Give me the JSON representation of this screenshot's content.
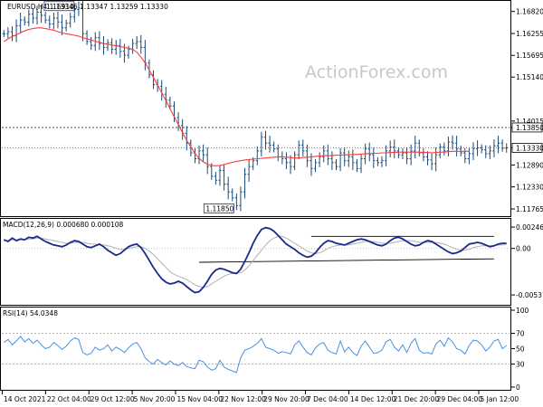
{
  "chart_data": {
    "type": "line",
    "price_panel": {
      "title": "EURUSD,H4  1.13346 1.13347 1.13259 1.13330",
      "ylim": [
        1.1735,
        1.1715
      ],
      "y_ticks": [
        "1.16820",
        "1.16255",
        "1.15695",
        "1.15140",
        "1.14015",
        "1.13850",
        "1.13330",
        "1.12890",
        "1.12330",
        "1.11765"
      ],
      "y_tick_values": [
        1.1682,
        1.16255,
        1.15695,
        1.1514,
        1.14015,
        1.1385,
        1.1333,
        1.1289,
        1.1233,
        1.11765
      ],
      "hidden_tick_note": "",
      "current_price_label": "1.13330",
      "current_price": 1.1333,
      "resistance_label": "1.13850",
      "resistance": 1.1385,
      "support_line": 1.1333,
      "high_label": "1.16910",
      "high_value": 1.1691,
      "low_label": "1.11850",
      "low_value": 1.1185,
      "watermark": "ActionForex.com",
      "ma_color": "#ff3b3b",
      "candle_color": "#1a4a78",
      "series": [
        {
          "role": "close",
          "values": [
            1.1625,
            1.163,
            1.162,
            1.1645,
            1.166,
            1.1655,
            1.1675,
            1.1665,
            1.168,
            1.1672,
            1.166,
            1.165,
            1.1665,
            1.1655,
            1.164,
            1.1652,
            1.1668,
            1.1687,
            1.1691,
            1.1625,
            1.1605,
            1.1595,
            1.1615,
            1.16,
            1.159,
            1.1602,
            1.1585,
            1.1595,
            1.158,
            1.157,
            1.1585,
            1.16,
            1.1605,
            1.159,
            1.155,
            1.152,
            1.1495,
            1.149,
            1.147,
            1.1455,
            1.144,
            1.141,
            1.139,
            1.137,
            1.1345,
            1.132,
            1.1305,
            1.1325,
            1.1315,
            1.1285,
            1.126,
            1.125,
            1.1275,
            1.124,
            1.122,
            1.1205,
            1.1185,
            1.122,
            1.1265,
            1.1285,
            1.13,
            1.1325,
            1.136,
            1.1345,
            1.134,
            1.133,
            1.131,
            1.1305,
            1.1295,
            1.1285,
            1.1315,
            1.134,
            1.1325,
            1.13,
            1.128,
            1.1295,
            1.131,
            1.1325,
            1.1305,
            1.1295,
            1.1285,
            1.132,
            1.13,
            1.131,
            1.1295,
            1.128,
            1.1305,
            1.133,
            1.1315,
            1.13,
            1.1295,
            1.13,
            1.1325,
            1.1335,
            1.1325,
            1.1315,
            1.132,
            1.1305,
            1.1325,
            1.1345,
            1.132,
            1.131,
            1.1302,
            1.1292,
            1.1315,
            1.1335,
            1.1325,
            1.1348,
            1.1345,
            1.133,
            1.132,
            1.1305,
            1.1318,
            1.1331,
            1.1333,
            1.1328,
            1.1318,
            1.1325,
            1.1338,
            1.1345,
            1.1332,
            1.1333
          ]
        },
        {
          "role": "ma",
          "values": [
            1.1605,
            1.1612,
            1.1618,
            1.1622,
            1.1628,
            1.1632,
            1.1636,
            1.1638,
            1.164,
            1.164,
            1.1638,
            1.1636,
            1.1634,
            1.163,
            1.1627,
            1.1625,
            1.1623,
            1.1621,
            1.1619,
            1.1615,
            1.1612,
            1.1609,
            1.1606,
            1.1603,
            1.16,
            1.1598,
            1.1596,
            1.1594,
            1.1592,
            1.159,
            1.1588,
            1.1585,
            1.1578,
            1.1565,
            1.155,
            1.1532,
            1.1513,
            1.1494,
            1.1474,
            1.1454,
            1.1433,
            1.1412,
            1.1392,
            1.1372,
            1.1352,
            1.1335,
            1.1319,
            1.1306,
            1.1297,
            1.1291,
            1.1288,
            1.1287,
            1.1288,
            1.129,
            1.1293,
            1.1296,
            1.1298,
            1.13,
            1.1302,
            1.1303,
            1.1304,
            1.1305,
            1.1306,
            1.1307,
            1.1308,
            1.1309,
            1.131,
            1.131,
            1.1309,
            1.1308,
            1.1307,
            1.1307,
            1.1308,
            1.1309,
            1.131,
            1.1311,
            1.1312,
            1.1313,
            1.1313,
            1.1313,
            1.1314,
            1.1314,
            1.1315,
            1.1315,
            1.1316,
            1.1316,
            1.1317,
            1.1318,
            1.1318,
            1.1319,
            1.1319,
            1.132,
            1.132,
            1.1321,
            1.1321,
            1.1322,
            1.1322,
            1.1322,
            1.1322,
            1.1322,
            1.1322,
            1.1321,
            1.1321,
            1.132,
            1.1321,
            1.1322,
            1.1322,
            1.1323,
            1.1324,
            1.1324,
            1.1324,
            1.1324,
            1.1324
          ]
        }
      ]
    },
    "macd_panel": {
      "title": "MACD(12,26,9) 0.000680 0.000108",
      "y_ticks": [
        "0.002469",
        "0.00",
        "-0.005375"
      ],
      "y_tick_values": [
        0.002469,
        0.0,
        -0.005375
      ],
      "ylim": [
        -0.0062,
        0.003
      ],
      "macd_color": "#1a2a8c",
      "signal_color": "#b0b0b0",
      "series": [
        {
          "role": "macd",
          "values": [
            0.001,
            0.0008,
            0.0012,
            0.0009,
            0.0011,
            0.001,
            0.0013,
            0.0012,
            0.0014,
            0.0011,
            0.0008,
            0.0006,
            0.0004,
            0.0003,
            0.0002,
            0.0004,
            0.0007,
            0.0009,
            0.0008,
            0.0005,
            0.0002,
            0.0001,
            0.0003,
            0.0005,
            0.0002,
            -0.0002,
            -0.0005,
            -0.0008,
            -0.0006,
            -0.0002,
            0.0002,
            0.0004,
            0.0005,
            0.0001,
            -0.0006,
            -0.0014,
            -0.0022,
            -0.0029,
            -0.0035,
            -0.0039,
            -0.0041,
            -0.004,
            -0.0038,
            -0.004,
            -0.0044,
            -0.0048,
            -0.0051,
            -0.005,
            -0.0045,
            -0.0038,
            -0.003,
            -0.0025,
            -0.0023,
            -0.0024,
            -0.0026,
            -0.0028,
            -0.0029,
            -0.0024,
            -0.0015,
            -0.0005,
            0.0006,
            0.0015,
            0.0022,
            0.0024,
            0.0023,
            0.002,
            0.0015,
            0.001,
            0.0005,
            0.0002,
            -0.0001,
            -0.0005,
            -0.0008,
            -0.001,
            -0.0009,
            -0.0005,
            0.0001,
            0.0006,
            0.0009,
            0.0008,
            0.0006,
            0.0005,
            0.0004,
            0.0006,
            0.0008,
            0.001,
            0.0011,
            0.001,
            0.0008,
            0.0006,
            0.0004,
            0.0003,
            0.0005,
            0.0009,
            0.0012,
            0.0013,
            0.0011,
            0.0008,
            0.0005,
            0.0003,
            0.0004,
            0.0007,
            0.0009,
            0.0008,
            0.0005,
            0.0002,
            -0.0001,
            -0.0004,
            -0.0006,
            -0.0005,
            -0.0003,
            0.0001,
            0.0005,
            0.0006,
            0.0007,
            0.0006,
            0.0004,
            0.0002,
            0.0003,
            0.0005,
            0.0006,
            0.0006
          ]
        },
        {
          "role": "signal",
          "values": [
            0.0009,
            0.0009,
            0.001,
            0.001,
            0.001,
            0.001,
            0.0011,
            0.0011,
            0.0012,
            0.0012,
            0.0011,
            0.001,
            0.0009,
            0.0008,
            0.0007,
            0.0006,
            0.0006,
            0.0007,
            0.0007,
            0.0007,
            0.0006,
            0.0005,
            0.0005,
            0.0004,
            0.0004,
            0.0003,
            0.0002,
            0.0,
            -0.0001,
            -0.0001,
            0.0,
            0.0001,
            0.0002,
            0.0002,
            0.0,
            -0.0003,
            -0.0007,
            -0.0012,
            -0.0017,
            -0.0022,
            -0.0027,
            -0.003,
            -0.0032,
            -0.0034,
            -0.0036,
            -0.0039,
            -0.0042,
            -0.0044,
            -0.0045,
            -0.0044,
            -0.0041,
            -0.0038,
            -0.0035,
            -0.0032,
            -0.003,
            -0.0029,
            -0.0029,
            -0.0028,
            -0.0025,
            -0.002,
            -0.0014,
            -0.0008,
            -0.0002,
            0.0004,
            0.0009,
            0.0012,
            0.0014,
            0.0014,
            0.0012,
            0.0009,
            0.0006,
            0.0003,
            0.0,
            -0.0003,
            -0.0005,
            -0.0006,
            -0.0005,
            -0.0003,
            0.0,
            0.0002,
            0.0003,
            0.0004,
            0.0004,
            0.0004,
            0.0005,
            0.0006,
            0.0007,
            0.0008,
            0.0008,
            0.0008,
            0.0007,
            0.0006,
            0.0006,
            0.0006,
            0.0007,
            0.0008,
            0.0009,
            0.0009,
            0.0009,
            0.0008,
            0.0007,
            0.0007,
            0.0007,
            0.0007,
            0.0007,
            0.0006,
            0.0005,
            0.0003,
            0.0001,
            -0.0001,
            -0.0002,
            -0.0002,
            -0.0001,
            0.0001,
            0.0002,
            0.0003,
            0.0003,
            0.0003,
            0.0003,
            0.0004,
            0.0004,
            0.0005
          ]
        }
      ]
    },
    "rsi_panel": {
      "title": "RSI(14) 54.0348",
      "y_ticks": [
        "100",
        "70",
        "50",
        "30",
        "0"
      ],
      "y_tick_values": [
        100,
        70,
        50,
        30,
        0
      ],
      "ylim": [
        0,
        100
      ],
      "rsi_color": "#4a90e2",
      "series": [
        {
          "role": "rsi",
          "values": [
            58,
            62,
            55,
            60,
            66,
            59,
            63,
            57,
            61,
            55,
            50,
            52,
            58,
            54,
            49,
            53,
            60,
            64,
            62,
            45,
            42,
            44,
            52,
            48,
            50,
            55,
            47,
            52,
            49,
            45,
            51,
            56,
            58,
            50,
            38,
            33,
            30,
            36,
            32,
            29,
            34,
            30,
            28,
            32,
            27,
            25,
            24,
            35,
            33,
            26,
            22,
            24,
            35,
            26,
            23,
            21,
            19,
            38,
            48,
            50,
            53,
            57,
            63,
            52,
            50,
            48,
            44,
            46,
            45,
            43,
            55,
            60,
            52,
            45,
            42,
            51,
            56,
            58,
            48,
            45,
            43,
            60,
            46,
            52,
            45,
            41,
            53,
            60,
            52,
            44,
            45,
            48,
            59,
            62,
            52,
            47,
            55,
            45,
            57,
            63,
            48,
            44,
            45,
            43,
            56,
            61,
            53,
            64,
            59,
            50,
            48,
            43,
            54,
            61,
            60,
            55,
            47,
            52,
            60,
            62,
            50,
            54
          ]
        }
      ]
    },
    "x_ticks": [
      "14 Oct 2021",
      "22 Oct 04:00",
      "29 Oct 12:00",
      "5 Nov 20:00",
      "15 Nov 04:00",
      "22 Nov 12:00",
      "29 Nov 20:00",
      "7 Dec 04:00",
      "14 Dec 12:00",
      "21 Dec 20:00",
      "29 Dec 04:00",
      "5 Jan 12:00"
    ]
  }
}
